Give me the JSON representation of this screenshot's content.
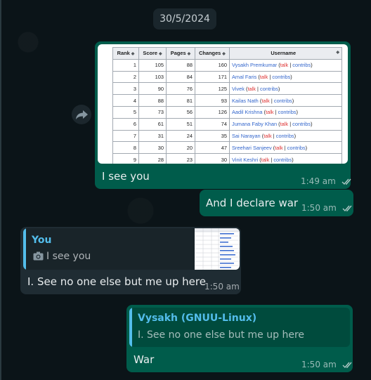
{
  "date_chip": "30/5/2024",
  "image_message": {
    "table": {
      "headers": [
        "Rank",
        "Score",
        "Pages",
        "Changes",
        "Username"
      ],
      "rows": [
        {
          "rank": "1",
          "score": "105",
          "pages": "88",
          "changes": "160",
          "user": "Vysakh Premkumar"
        },
        {
          "rank": "2",
          "score": "103",
          "pages": "84",
          "changes": "171",
          "user": "Amal Faris"
        },
        {
          "rank": "3",
          "score": "90",
          "pages": "76",
          "changes": "125",
          "user": "Vivek"
        },
        {
          "rank": "4",
          "score": "88",
          "pages": "81",
          "changes": "93",
          "user": "Kailas Nath"
        },
        {
          "rank": "5",
          "score": "73",
          "pages": "56",
          "changes": "126",
          "user": "Aadil Krishna"
        },
        {
          "rank": "6",
          "score": "61",
          "pages": "51",
          "changes": "74",
          "user": "Jumana Faby Khan"
        },
        {
          "rank": "7",
          "score": "31",
          "pages": "24",
          "changes": "35",
          "user": "Sai Narayan"
        },
        {
          "rank": "8",
          "score": "30",
          "pages": "20",
          "changes": "47",
          "user": "Sreehari Sanjeev"
        },
        {
          "rank": "9",
          "score": "28",
          "pages": "23",
          "changes": "30",
          "user": "Vinit Keshri"
        }
      ],
      "talk_label": "talk",
      "contribs_label": "contribs",
      "separator": "|"
    },
    "caption": "I see you",
    "time": "1:49 am"
  },
  "msg_declare": {
    "text": "And I declare war",
    "time": "1:50 am"
  },
  "msg_reply_in": {
    "quote_author": "You",
    "quote_text": "I see you",
    "text": "I. See no one else but me up here",
    "time": "1:50 am"
  },
  "msg_war": {
    "quote_author": "Vysakh (GNUU-Linux)",
    "quote_text": "I. See no one else but me up here",
    "text": "War",
    "time": "1:50 am"
  },
  "colors": {
    "outgoing_bubble": "#005c4b",
    "incoming_bubble": "#1f2c33",
    "quote_you": "#53bdeb",
    "quote_vysakh": "#53bdeb",
    "read_ticks": "#e9edef"
  },
  "icons": [
    "forward-icon",
    "camera-icon",
    "double-check-icon"
  ]
}
